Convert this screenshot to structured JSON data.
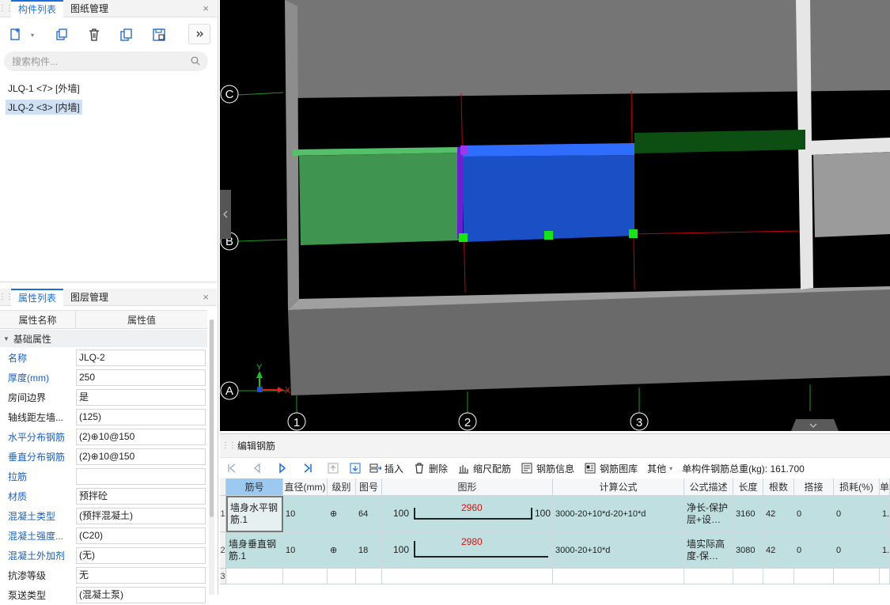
{
  "left_top": {
    "tabs": [
      "构件列表",
      "图纸管理"
    ],
    "close": "×",
    "search_placeholder": "搜索构件...",
    "items": [
      "JLQ-1 <7> [外墙]",
      "JLQ-2 <3> [内墙]"
    ],
    "selected_index": 1
  },
  "left_bottom": {
    "tabs": [
      "属性列表",
      "图层管理"
    ],
    "close": "×",
    "col_name": "属性名称",
    "col_value": "属性值",
    "group": "基础属性",
    "props": [
      {
        "name": "名称",
        "value": "JLQ-2",
        "blue": true
      },
      {
        "name": "厚度(mm)",
        "value": "250",
        "blue": true
      },
      {
        "name": "房间边界",
        "value": "是",
        "blue": false
      },
      {
        "name": "轴线距左墙...",
        "value": "(125)",
        "blue": false
      },
      {
        "name": "水平分布钢筋",
        "value": "(2)⊕10@150",
        "blue": true
      },
      {
        "name": "垂直分布钢筋",
        "value": "(2)⊕10@150",
        "blue": true
      },
      {
        "name": "拉筋",
        "value": "",
        "blue": true
      },
      {
        "name": "材质",
        "value": "预拌砼",
        "blue": true
      },
      {
        "name": "混凝土类型",
        "value": "(预拌混凝土)",
        "blue": true
      },
      {
        "name": "混凝土强度...",
        "value": "(C20)",
        "blue": true
      },
      {
        "name": "混凝土外加剂",
        "value": "(无)",
        "blue": true
      },
      {
        "name": "抗渗等级",
        "value": "无",
        "blue": false
      },
      {
        "name": "泵送类型",
        "value": "(混凝土泵)",
        "blue": false
      }
    ]
  },
  "viewport": {
    "axis_rows": [
      "C",
      "B",
      "A"
    ],
    "axis_cols": [
      "1",
      "2",
      "3"
    ],
    "axis_x": "X",
    "axis_y": "Y",
    "colors": {
      "green_wall": "#3f944f",
      "blue_wall": "#1a4fc6",
      "gray": "#7a7a7a",
      "grid": "#d00000"
    }
  },
  "bottom": {
    "title": "编辑钢筋",
    "toolbar": {
      "insert": "插入",
      "delete": "删除",
      "scale": "缩尺配筋",
      "info": "钢筋信息",
      "library": "钢筋图库",
      "other": "其他",
      "total": "单构件钢筋总重(kg): 161.700"
    },
    "columns": [
      "筋号",
      "直径(mm)",
      "级别",
      "图号",
      "图形",
      "计算公式",
      "公式描述",
      "长度",
      "根数",
      "搭接",
      "损耗(%)",
      "单"
    ],
    "rows": [
      {
        "num": "1",
        "name": "墙身水平钢筋.1",
        "dia": "10",
        "grade": "⊕",
        "fig": "64",
        "shape_left": "100",
        "shape_mid": "2960",
        "shape_right": "100",
        "formula": "3000-20+10*d-20+10*d",
        "desc": "净长-保护层+设…",
        "length": "3160",
        "count": "42",
        "lap": "0",
        "loss": "0",
        "unit": "1."
      },
      {
        "num": "2",
        "name": "墙身垂直钢筋.1",
        "dia": "10",
        "grade": "⊕",
        "fig": "18",
        "shape_left": "100",
        "shape_mid": "2980",
        "shape_right": "",
        "formula": "3000-20+10*d",
        "desc": "墙实际高度-保…",
        "length": "3080",
        "count": "42",
        "lap": "0",
        "loss": "0",
        "unit": "1."
      },
      {
        "num": "3",
        "name": "",
        "dia": "",
        "grade": "",
        "fig": "",
        "shape_left": "",
        "shape_mid": "",
        "shape_right": "",
        "formula": "",
        "desc": "",
        "length": "",
        "count": "",
        "lap": "",
        "loss": "",
        "unit": ""
      }
    ]
  }
}
